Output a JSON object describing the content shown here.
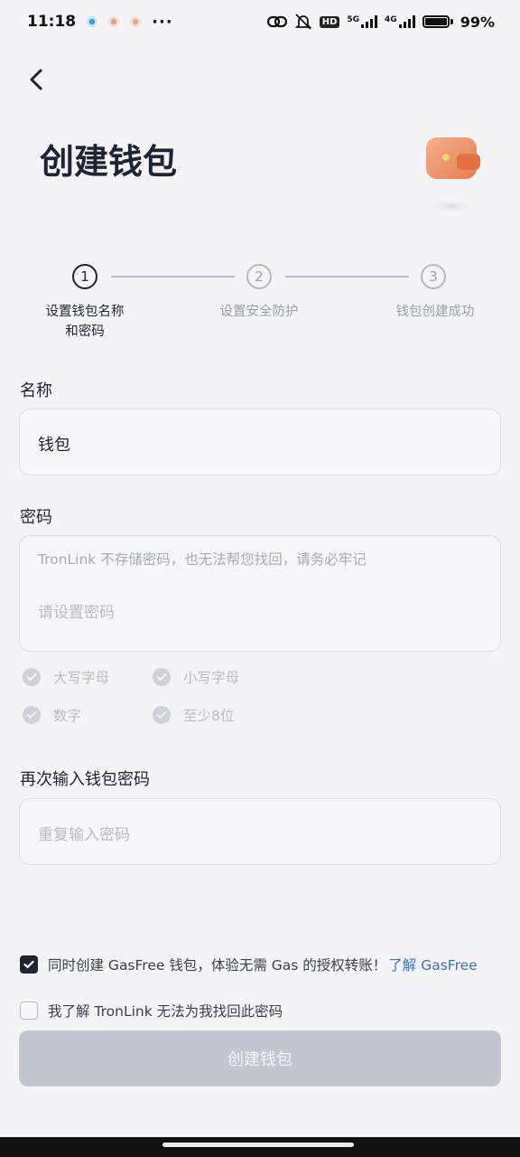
{
  "status_bar": {
    "time": "11:18",
    "more": "···",
    "network_hd": "HD",
    "network_5g": "5G",
    "network_4g": "4G",
    "battery": "99%"
  },
  "header": {
    "title": "创建钱包"
  },
  "stepper": {
    "steps": [
      {
        "number": "1",
        "label": "设置钱包名称和密码"
      },
      {
        "number": "2",
        "label": "设置安全防护"
      },
      {
        "number": "3",
        "label": "钱包创建成功"
      }
    ]
  },
  "name_field": {
    "label": "名称",
    "value": "钱包"
  },
  "password_field": {
    "label": "密码",
    "hint": "TronLink 不存储密码，也无法帮您找回，请务必牢记",
    "placeholder": "请设置密码"
  },
  "password_rules": [
    "大写字母",
    "小写字母",
    "数字",
    "至少8位"
  ],
  "confirm_field": {
    "label": "再次输入钱包密码",
    "placeholder": "重复输入密码"
  },
  "agreements": {
    "gasfree_text": "同时创建 GasFree 钱包，体验无需 Gas 的授权转账！",
    "gasfree_link": "了解 GasFree",
    "gasfree_checked": true,
    "password_ack_text": "我了解 TronLink 无法为我找回此密码",
    "password_ack_checked": false
  },
  "create_button": {
    "label": "创建钱包"
  },
  "colors": {
    "primary_dark": "#1f2433",
    "button_disabled": "#c3c6d1",
    "link": "#3b70c8",
    "wallet_orange": "#f0956a"
  },
  "icons": [
    "back-arrow-icon",
    "wallet-icon",
    "check-icon"
  ]
}
